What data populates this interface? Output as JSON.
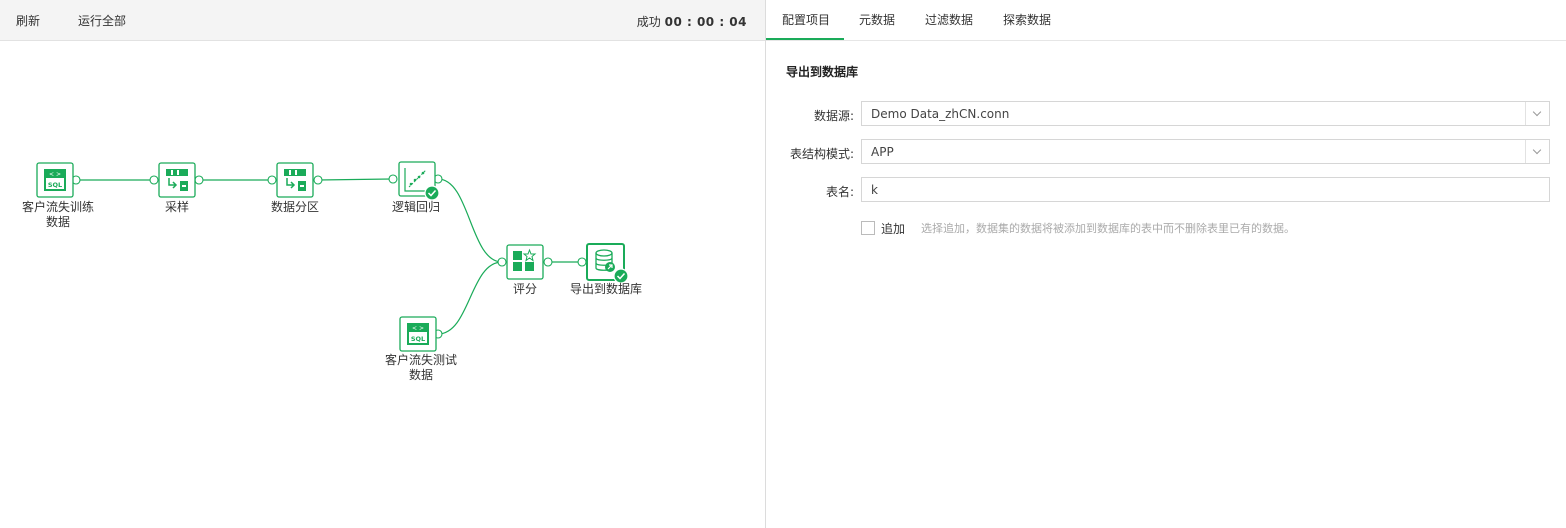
{
  "toolbar": {
    "refresh_label": "刷新",
    "run_all_label": "运行全部",
    "status_text": "成功",
    "status_time": "00 : 00 : 04"
  },
  "flow": {
    "nodes": [
      {
        "id": "train",
        "label_line1": "客户流失训练",
        "label_line2": "数据",
        "icon": "sql-icon"
      },
      {
        "id": "sample",
        "label_line1": "采样",
        "icon": "sample-icon"
      },
      {
        "id": "partition",
        "label_line1": "数据分区",
        "icon": "partition-icon"
      },
      {
        "id": "logistic",
        "label_line1": "逻辑回归",
        "icon": "regression-icon"
      },
      {
        "id": "score",
        "label_line1": "评分",
        "icon": "score-icon"
      },
      {
        "id": "export",
        "label_line1": "导出到数据库",
        "icon": "database-export-icon"
      },
      {
        "id": "test",
        "label_line1": "客户流失测试",
        "label_line2": "数据",
        "icon": "sql-icon"
      }
    ],
    "sql_text": "SQL",
    "accent_color": "#1aab59"
  },
  "tabs": [
    {
      "label": "配置项目"
    },
    {
      "label": "元数据"
    },
    {
      "label": "过滤数据"
    },
    {
      "label": "探索数据"
    }
  ],
  "config": {
    "section_title": "导出到数据库",
    "datasource_label": "数据源:",
    "datasource_value": "Demo Data_zhCN.conn",
    "schema_label": "表结构模式:",
    "schema_value": "APP",
    "table_label": "表名:",
    "table_value": "k",
    "append_label": "追加",
    "append_hint": "选择追加，数据集的数据将被添加到数据库的表中而不删除表里已有的数据。"
  }
}
